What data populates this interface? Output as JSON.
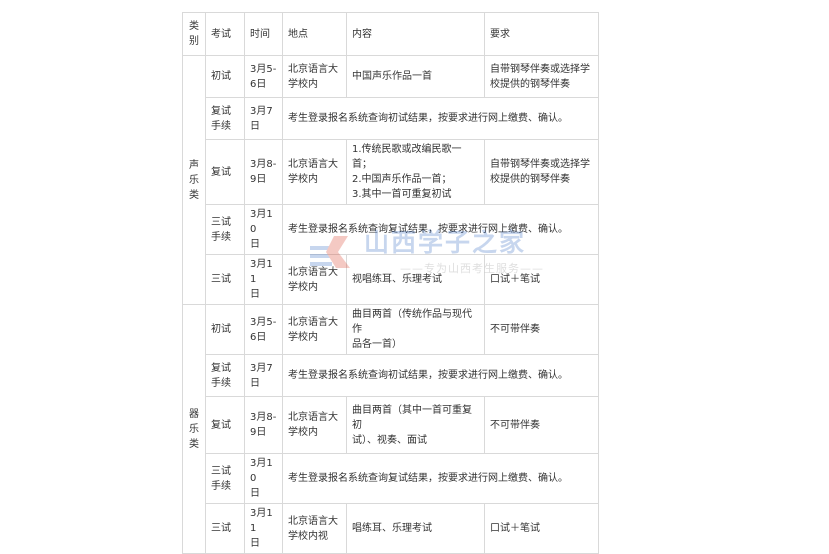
{
  "header": {
    "category": [
      "类",
      "别"
    ],
    "stage": "考试",
    "time": "时间",
    "place": "地点",
    "content": "内容",
    "requirement": "要求"
  },
  "vocal": {
    "category": [
      "声",
      "乐",
      "类"
    ],
    "rows": [
      {
        "stage": [
          "初试"
        ],
        "time": [
          "3月5-",
          "6日"
        ],
        "place": [
          "北京语言大",
          "学校内"
        ],
        "content": [
          "中国声乐作品一首"
        ],
        "requirement": [
          "自带钢琴伴奏或选择学",
          "校提供的钢琴伴奏"
        ]
      },
      {
        "stage": [
          "复试",
          "手续"
        ],
        "time": [
          "3月7",
          "日"
        ],
        "merged": "考生登录报名系统查询初试结果，按要求进行网上缴费、确认。"
      },
      {
        "stage": [
          "复试"
        ],
        "time": [
          "3月8-",
          "9日"
        ],
        "place": [
          "北京语言大",
          "学校内"
        ],
        "content": [
          "1.传统民歌或改编民歌一首；",
          "2.中国声乐作品一首；",
          "3.其中一首可重复初试"
        ],
        "requirement": [
          "自带钢琴伴奏或选择学",
          "校提供的钢琴伴奏"
        ]
      },
      {
        "stage": [
          "三试",
          "手续"
        ],
        "time": [
          "3月10",
          "日"
        ],
        "merged": "考生登录报名系统查询复试结果，按要求进行网上缴费、确认。"
      },
      {
        "stage": [
          "三试"
        ],
        "time": [
          "3月11",
          "日"
        ],
        "place": [
          "北京语言大",
          "学校内"
        ],
        "content": [
          "视唱练耳、乐理考试"
        ],
        "requirement": [
          "口试＋笔试"
        ]
      }
    ]
  },
  "instrumental": {
    "category": [
      "器",
      "乐",
      "类"
    ],
    "rows": [
      {
        "stage": [
          "初试"
        ],
        "time": [
          "3月5-",
          "6日"
        ],
        "place": [
          "北京语言大",
          "学校内"
        ],
        "content": [
          "曲目两首（传统作品与现代作",
          "品各一首）"
        ],
        "requirement": [
          "不可带伴奏"
        ]
      },
      {
        "stage": [
          "复试",
          "手续"
        ],
        "time": [
          "3月7",
          "日"
        ],
        "merged": "考生登录报名系统查询初试结果，按要求进行网上缴费、确认。"
      },
      {
        "stage": [
          "复试"
        ],
        "time": [
          "3月8-",
          "9日"
        ],
        "place": [
          "北京语言大",
          "学校内"
        ],
        "content": [
          "曲目两首（其中一首可重复初",
          "试）、视奏、面试"
        ],
        "requirement": [
          "不可带伴奏"
        ]
      },
      {
        "stage": [
          "三试",
          "手续"
        ],
        "time": [
          "3月10",
          "日"
        ],
        "merged": "考生登录报名系统查询复试结果，按要求进行网上缴费、确认。"
      },
      {
        "stage": [
          "三试"
        ],
        "time": [
          "3月11",
          "日"
        ],
        "place": [
          "北京语言大",
          "学校内视"
        ],
        "content": [
          "唱练耳、乐理考试"
        ],
        "requirement": [
          "口试＋笔试"
        ]
      }
    ]
  },
  "watermark": {
    "title": "山西学子之家",
    "subtitle": "——专为山西考生服务——",
    "colors": {
      "blue": "#3a6fc4",
      "red": "#d9412d"
    }
  }
}
